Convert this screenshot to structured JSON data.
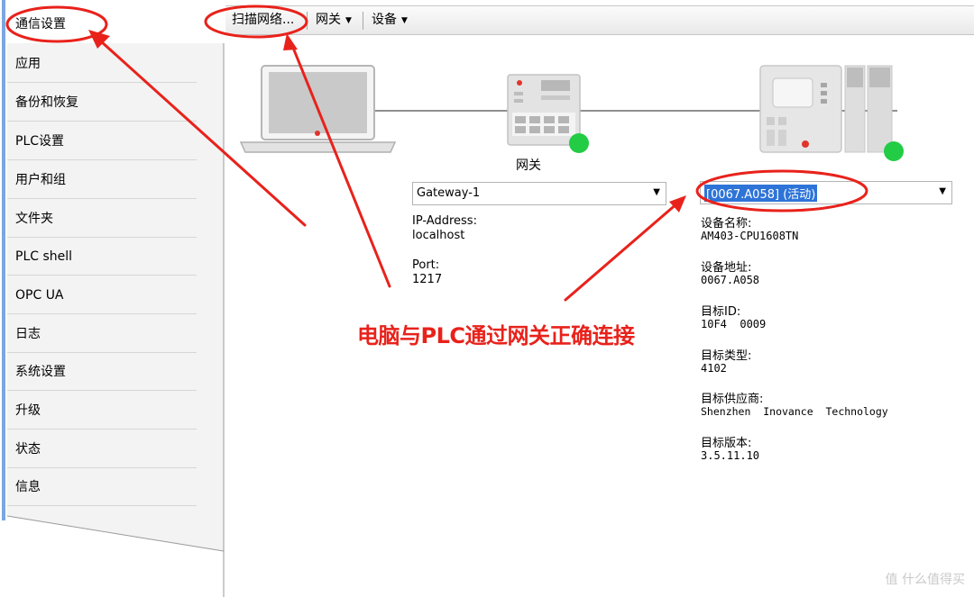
{
  "sidebar": {
    "items": [
      {
        "label": "通信设置"
      },
      {
        "label": "应用"
      },
      {
        "label": "备份和恢复"
      },
      {
        "label": "PLC设置"
      },
      {
        "label": "用户和组"
      },
      {
        "label": "文件夹"
      },
      {
        "label": "PLC shell"
      },
      {
        "label": "OPC UA"
      },
      {
        "label": "日志"
      },
      {
        "label": "系统设置"
      },
      {
        "label": "升级"
      },
      {
        "label": "状态"
      },
      {
        "label": "信息"
      }
    ]
  },
  "toolbar": {
    "scan_label": "扫描网络...",
    "gateway_label": "网关",
    "device_label": "设备"
  },
  "diagram": {
    "gateway_caption": "网关",
    "status_color": "#22cc44"
  },
  "gateway": {
    "selected": "Gateway-1",
    "ip_label": "IP-Address:",
    "ip_value": "localhost",
    "port_label": "Port:",
    "port_value": "1217"
  },
  "device": {
    "selected": "[0067.A058] (活动)",
    "fields": [
      {
        "label": "设备名称:",
        "value": "AM403-CPU1608TN"
      },
      {
        "label": "设备地址:",
        "value": "0067.A058"
      },
      {
        "label": "目标ID:",
        "value": "10F4  0009"
      },
      {
        "label": "目标类型:",
        "value": "4102"
      },
      {
        "label": "目标供应商:",
        "value": "Shenzhen  Inovance  Technology"
      },
      {
        "label": "目标版本:",
        "value": "3.5.11.10"
      }
    ]
  },
  "annotation": {
    "text": "电脑与PLC通过网关正确连接",
    "color": "#e8221b"
  },
  "watermark": {
    "text": "值 什么值得买"
  }
}
